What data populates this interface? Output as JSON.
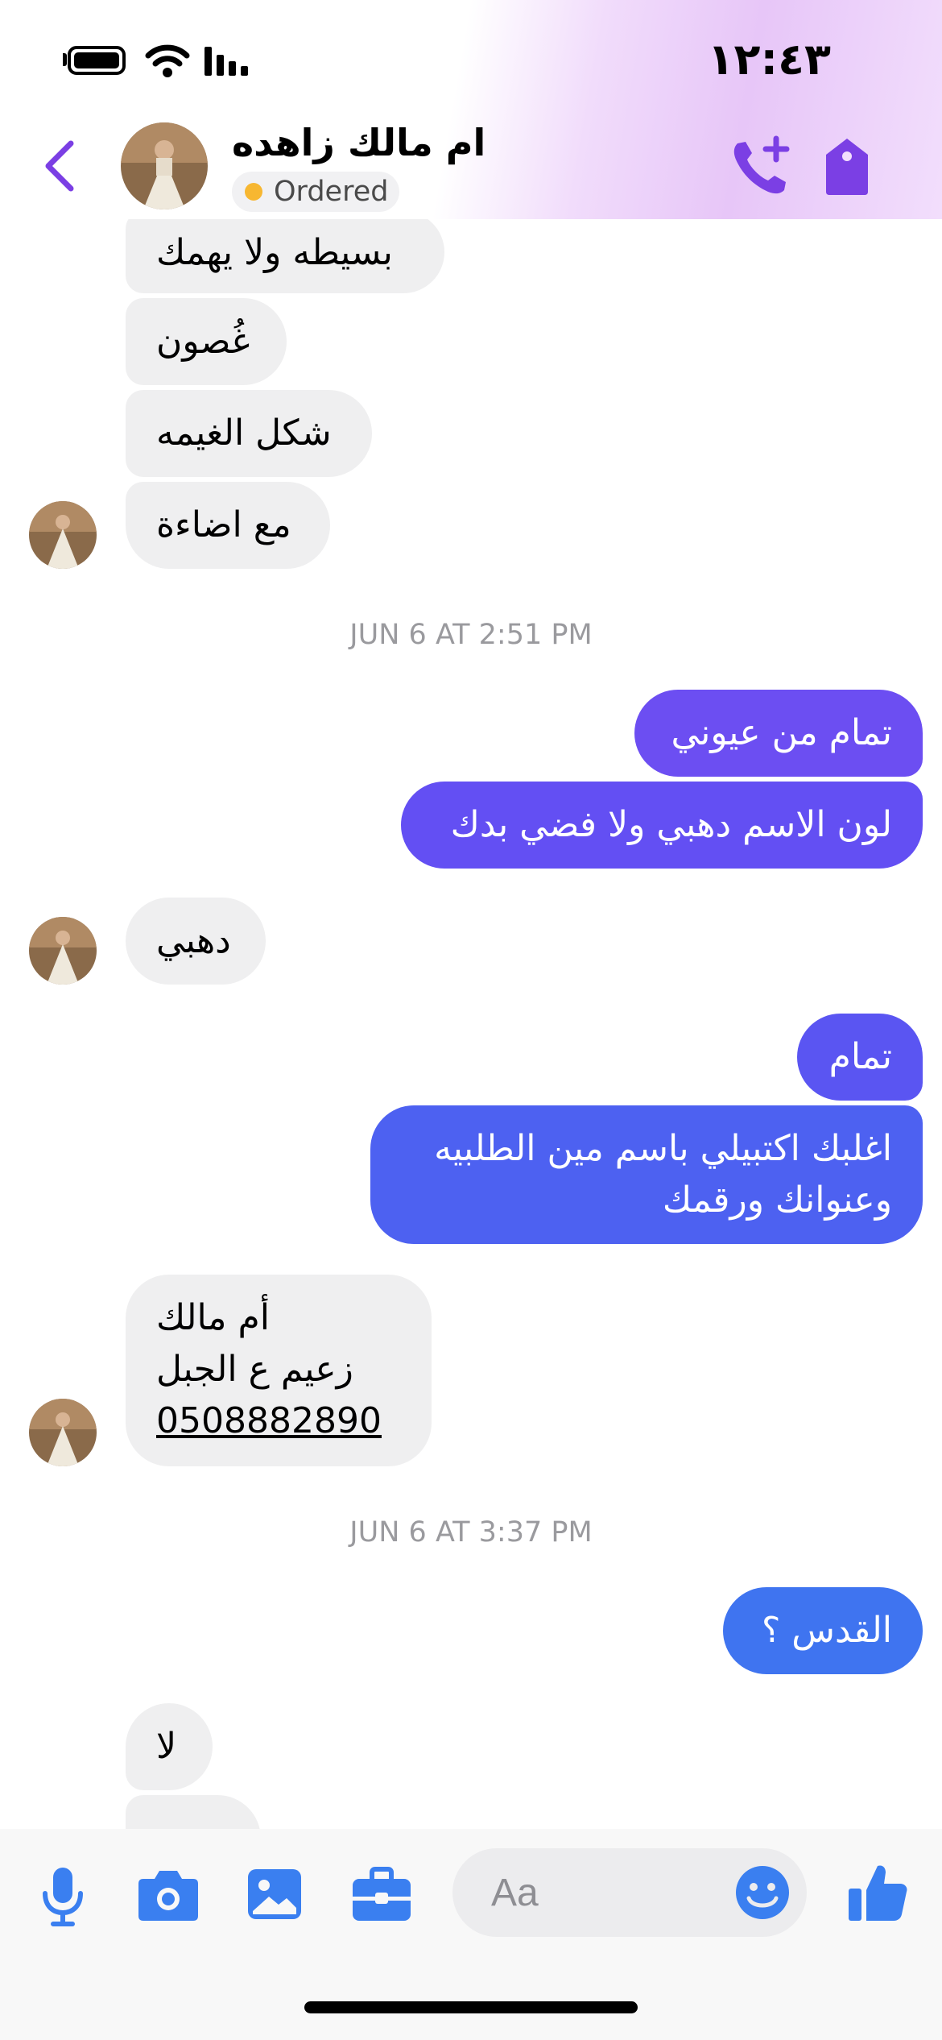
{
  "status_bar": {
    "time": "١٢:٤٣"
  },
  "header": {
    "contact_name": "ام مالك زاهده",
    "status_label": "Ordered",
    "status_color": "#f7b731",
    "icons": [
      "back-chevron-icon",
      "add-call-icon",
      "tag-icon"
    ]
  },
  "messages": {
    "m1": "بسيطه ولا يهمك",
    "m2": "غُصون",
    "m3": "شكل الغيمه",
    "m4": "مع اضاءة",
    "ts1": "JUN 6 AT 2:51 PM",
    "m5": "تمام من عيوني",
    "m6": "لون الاسم دهبي ولا فضي بدك",
    "m7": "دهبي",
    "m8": "تمام",
    "m9_line1": "اغلبك اكتبيلي باسم مين الطلبيه",
    "m9_line2": "وعنوانك ورقمك",
    "m10_line1": "أم مالك",
    "m10_line2": "زعيم ع الجبل",
    "m10_phone": "0508882890",
    "ts2": "JUN 6 AT 3:37 PM",
    "m11": "القدس ؟",
    "m12": "لا"
  },
  "composer": {
    "placeholder": "Aa",
    "icons": [
      "mic-icon",
      "camera-icon",
      "photo-icon",
      "toolbox-icon",
      "emoji-icon",
      "thumbs-up-icon"
    ]
  },
  "colors": {
    "accent": "#7b3fe4",
    "outgoing_top": "#6a4ff4",
    "outgoing_bottom": "#3f6ff0",
    "incoming": "#efeff0",
    "icon_blue": "#3a7ff0"
  }
}
